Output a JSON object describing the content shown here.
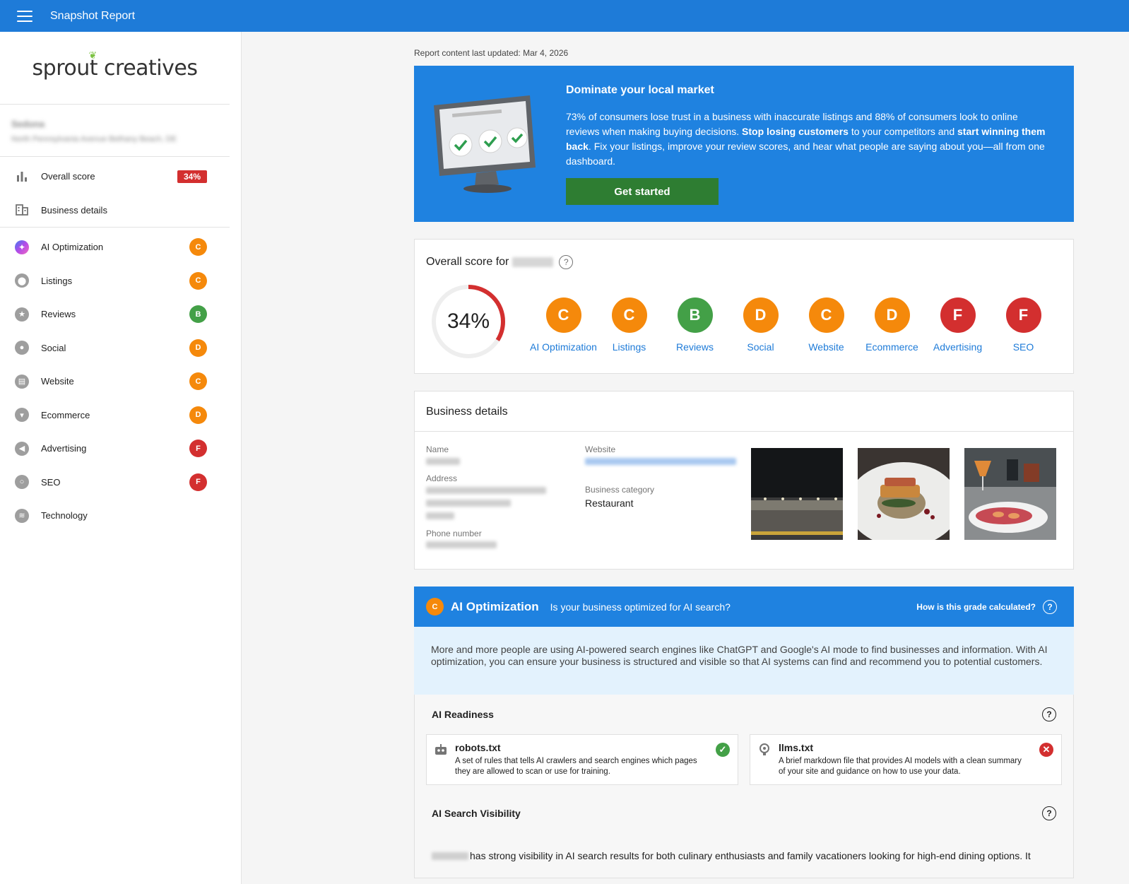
{
  "topbar": {
    "title": "Snapshot Report"
  },
  "sidebar": {
    "logo": "sprout creatives",
    "overall_label": "Overall score",
    "overall_value": "34%",
    "business_details_label": "Business details",
    "items": [
      {
        "label": "AI Optimization",
        "grade": "C",
        "icon": "sparkle-icon"
      },
      {
        "label": "Listings",
        "grade": "C",
        "icon": "location-pin-icon"
      },
      {
        "label": "Reviews",
        "grade": "B",
        "icon": "star-icon"
      },
      {
        "label": "Social",
        "grade": "D",
        "icon": "chat-icon"
      },
      {
        "label": "Website",
        "grade": "C",
        "icon": "browser-icon"
      },
      {
        "label": "Ecommerce",
        "grade": "D",
        "icon": "cart-icon"
      },
      {
        "label": "Advertising",
        "grade": "F",
        "icon": "megaphone-icon"
      },
      {
        "label": "SEO",
        "grade": "F",
        "icon": "magnifier-icon"
      },
      {
        "label": "Technology",
        "grade": "",
        "icon": "layers-icon"
      }
    ]
  },
  "report": {
    "updated_label": "Report content last updated:",
    "updated_date": "Mar 4, 2026"
  },
  "banner": {
    "title": "Dominate your local market",
    "text_1": "73% of consumers lose trust in a business with inaccurate listings and 88% of consumers look to online reviews when making buying decisions. ",
    "bold_1": "Stop losing customers",
    "text_2": " to your competitors and ",
    "bold_2": "start winning them back",
    "text_3": ". Fix your listings, improve your review scores, and hear what people are saying about you—all from one dashboard.",
    "cta": "Get started"
  },
  "overall": {
    "title": "Overall score for",
    "score_text": "34%",
    "score_fraction": 0.34,
    "grades": [
      {
        "grade": "C",
        "label": "AI Optimization"
      },
      {
        "grade": "C",
        "label": "Listings"
      },
      {
        "grade": "B",
        "label": "Reviews"
      },
      {
        "grade": "D",
        "label": "Social"
      },
      {
        "grade": "C",
        "label": "Website"
      },
      {
        "grade": "D",
        "label": "Ecommerce"
      },
      {
        "grade": "F",
        "label": "Advertising"
      },
      {
        "grade": "F",
        "label": "SEO"
      }
    ]
  },
  "business": {
    "title": "Business details",
    "name_label": "Name",
    "address_label": "Address",
    "phone_label": "Phone number",
    "website_label": "Website",
    "category_label": "Business category",
    "category_value": "Restaurant"
  },
  "ai": {
    "grade": "C",
    "title": "AI Optimization",
    "subtitle": "Is your business optimized for AI search?",
    "how_label": "How is this grade calculated?",
    "intro": "More and more people are using AI-powered search engines like ChatGPT and Google's AI mode to find businesses and information. With AI optimization, you can ensure your business is structured and visible so that AI systems can find and recommend you to potential customers.",
    "readiness_title": "AI Readiness",
    "robots_title": "robots.txt",
    "robots_desc": "A set of rules that tells AI crawlers and search engines which pages they are allowed to scan or use for training.",
    "llms_title": "llms.txt",
    "llms_desc": "A brief markdown file that provides AI models with a clean summary of your site and guidance on how to use your data.",
    "visibility_title": "AI Search Visibility",
    "visibility_text": "has strong visibility in AI search results for both culinary enthusiasts and family vacationers looking for high-end dining options. It"
  },
  "colors": {
    "primary": "#1f82e0",
    "grade_c": "#f5890b",
    "grade_b": "#43a047",
    "grade_f": "#d32f2f",
    "cta": "#2e7d32"
  }
}
